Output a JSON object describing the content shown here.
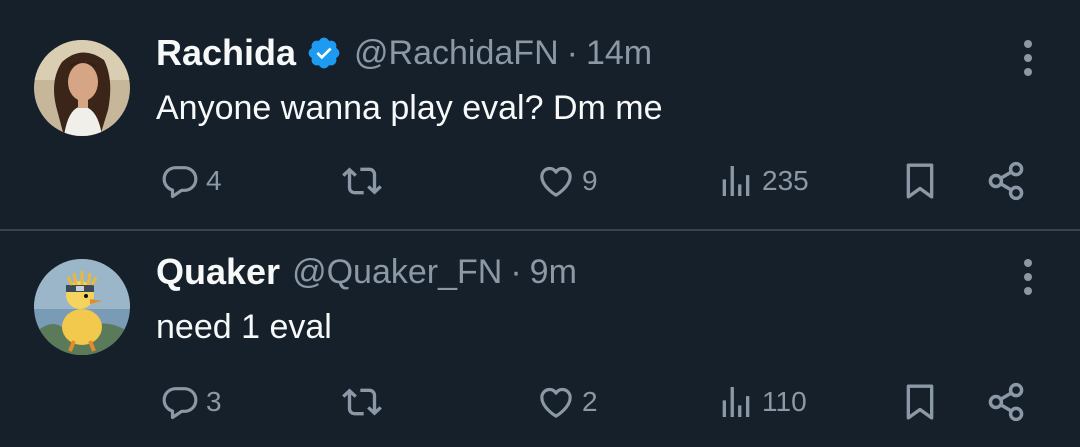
{
  "tweets": [
    {
      "display_name": "Rachida",
      "verified": true,
      "handle": "@RachidaFN",
      "separator": "·",
      "time": "14m",
      "text": "Anyone wanna play eval? Dm me",
      "replies": "4",
      "retweets": "",
      "likes": "9",
      "views": "235"
    },
    {
      "display_name": "Quaker",
      "verified": false,
      "handle": "@Quaker_FN",
      "separator": "·",
      "time": "9m",
      "text": "need 1 eval",
      "replies": "3",
      "retweets": "",
      "likes": "2",
      "views": "110"
    }
  ],
  "colors": {
    "background": "#15202b",
    "divider": "#38444d",
    "primary_text": "#f7f9f9",
    "secondary_text": "#8b98a5",
    "verified_blue": "#1d9bf0"
  },
  "icons": [
    "reply-icon",
    "retweet-icon",
    "like-icon",
    "views-icon",
    "bookmark-icon",
    "share-icon",
    "more-icon",
    "verified-badge-icon"
  ]
}
